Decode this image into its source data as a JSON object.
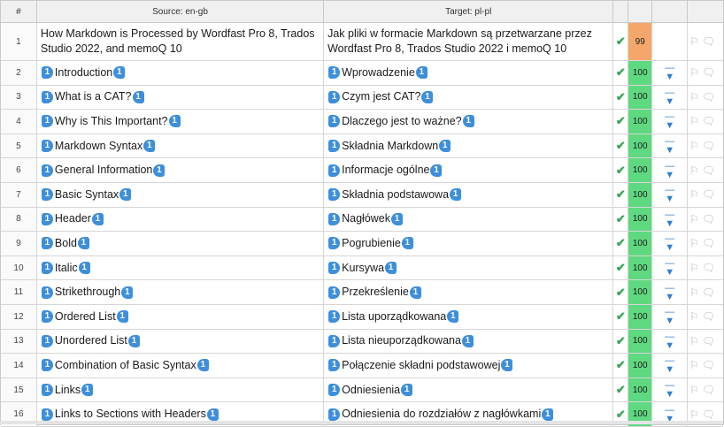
{
  "header": {
    "num": "#",
    "source": "Source: en-gb",
    "target": "Target: pl-pl"
  },
  "icons": {
    "status": "check-icon",
    "arrow": "download-arrow-icon",
    "note": "flag-icon",
    "comment": "comment-bubble-icon"
  },
  "colors": {
    "score_exact": "#5fd97f",
    "score_fuzzy": "#f5a76b",
    "tag": "#3d8fdb"
  },
  "rows": [
    {
      "num": "1",
      "source": "How Markdown is Processed by Wordfast Pro 8, Trados Studio 2022, and memoQ 10",
      "target": "Jak pliki w formacie Markdown są przetwarzane przez Wordfast Pro 8, Trados Studio 2022 i memoQ 10",
      "score": "99"
    },
    {
      "num": "2",
      "source": "Introduction",
      "target": "Wprowadzenie",
      "score": "100"
    },
    {
      "num": "3",
      "source": "What is a CAT?",
      "target": "Czym jest CAT?",
      "score": "100"
    },
    {
      "num": "4",
      "source": "Why is This Important?",
      "target": "Dlaczego jest to ważne?",
      "score": "100"
    },
    {
      "num": "5",
      "source": "Markdown Syntax",
      "target": "Składnia Markdown",
      "score": "100"
    },
    {
      "num": "6",
      "source": "General Information",
      "target": "Informacje ogólne",
      "score": "100"
    },
    {
      "num": "7",
      "source": "Basic Syntax",
      "target": "Składnia podstawowa",
      "score": "100"
    },
    {
      "num": "8",
      "source": "Header",
      "target": "Nagłówek",
      "score": "100"
    },
    {
      "num": "9",
      "source": "Bold",
      "target": "Pogrubienie",
      "score": "100"
    },
    {
      "num": "10",
      "source": "Italic",
      "target": "Kursywa",
      "score": "100"
    },
    {
      "num": "11",
      "source": "Strikethrough",
      "target": "Przekreślenie",
      "score": "100"
    },
    {
      "num": "12",
      "source": "Ordered List",
      "target": "Lista uporządkowana",
      "score": "100"
    },
    {
      "num": "13",
      "source": "Unordered List",
      "target": "Lista nieuporządkowana",
      "score": "100"
    },
    {
      "num": "14",
      "source": "Combination of Basic Syntax",
      "target": "Połączenie składni podstawowej",
      "score": "100"
    },
    {
      "num": "15",
      "source": "Links",
      "target": "Odniesienia",
      "score": "100"
    },
    {
      "num": "16",
      "source": "Links to Sections with Headers",
      "target": "Odniesienia do rozdziałów z nagłówkami",
      "score": "100"
    }
  ],
  "tag_label": "1"
}
